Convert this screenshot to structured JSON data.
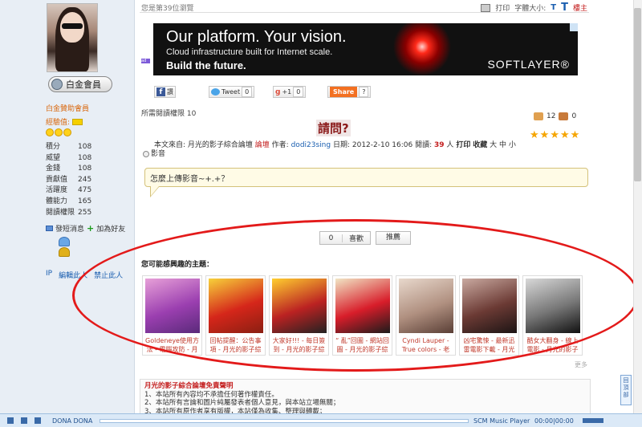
{
  "left": {
    "member_badge": "白金會員",
    "role": "白金贊助會員",
    "exp_label": "經驗值:",
    "stats": [
      {
        "k": "積分",
        "v": "108"
      },
      {
        "k": "威望",
        "v": "108"
      },
      {
        "k": "金錢",
        "v": "108"
      },
      {
        "k": "貢獻值",
        "v": "245"
      },
      {
        "k": "活躍度",
        "v": "475"
      },
      {
        "k": "體能力",
        "v": "165"
      },
      {
        "k": "閱讀權限",
        "v": "255"
      }
    ],
    "send_message": "發短消息",
    "add_friend": "加為好友",
    "ip": "IP",
    "edit_user": "編輯此人",
    "ban_user": "禁止此人"
  },
  "top": {
    "rank": "您是第39位瀏覽",
    "print": "打印",
    "font_size_label": "字體大小:",
    "font_small": "T",
    "font_large": "T",
    "floor": "樓主"
  },
  "ad": {
    "headline": "Our platform. Your vision.",
    "subline": "Cloud infrastructure built for Internet scale.",
    "cta": "Build the future.",
    "brand": "SOFTLAYER®",
    "tag": "ad"
  },
  "share": {
    "fb": "讚",
    "tweet": "Tweet",
    "tweet_count": "0",
    "gplus": "+1",
    "gplus_count": "0",
    "share_label": "Share",
    "share_count": "?"
  },
  "post": {
    "read_perm": "所需閱讀權限 10",
    "title": "請問?",
    "meta_from": "本文來自: 月光的影子綜合論壇",
    "meta_board": "論壇",
    "meta_author_label": "作者:",
    "meta_author": "dodi23sing",
    "meta_date": "日期: 2012-2-10 16:06 閱讀:",
    "meta_reads": "39",
    "meta_reads_unit": "人",
    "meta_print": "打印",
    "meta_collect": "收藏",
    "meta_sizes": "大 中 小",
    "meta_category": "影音",
    "thumbs_up": "12",
    "thumbs_down": "0",
    "content": "怎麼上傳影音~+.+？"
  },
  "actions": {
    "like_count": "0",
    "like_label": "喜歡",
    "recommend_label": "推薦"
  },
  "related": {
    "title": "您可能感興趣的主題：",
    "more": "更多",
    "items": [
      {
        "caption": "Goldeneye使用方法 - 電腦攻防 - 月",
        "colors": [
          "#e7a0d8",
          "#9b3fb0",
          "#5a2a7a"
        ]
      },
      {
        "caption": "回帖提醒：公告事項 - 月光的影子綜",
        "colors": [
          "#f7d23a",
          "#d5261a",
          "#8a1f12"
        ]
      },
      {
        "caption": "大家好!!! - 每日簽到 - 月光的影子綜",
        "colors": [
          "#ffcf2f",
          "#b22",
          "#222"
        ]
      },
      {
        "caption": "“ 亂”回圖 - 網站回圖 - 月光的影子綜",
        "colors": [
          "#f1e6c5",
          "#d81d2a",
          "#1b1b1b"
        ]
      },
      {
        "caption": "Cyndi Lauper - True colors - 老式",
        "colors": [
          "#e8d8cc",
          "#b09080",
          "#5a3f36"
        ]
      },
      {
        "caption": "凶宅驚悚 - 最新迅雷電影下載 - 月光",
        "colors": [
          "#c9a9a0",
          "#6b3a34",
          "#1c1414"
        ]
      },
      {
        "caption": "酷女大翻身 - 線上電影 - 月光的影子",
        "colors": [
          "#d8d8d8",
          "#777",
          "#111"
        ]
      }
    ]
  },
  "disclaimer": {
    "title": "月光的影子綜合論壇免責聲明",
    "line1": "1、本站所有內容均不承擔任何著作權責任。",
    "line2": "2、本站所有言論和圖片純屬發表者個人意見，與本站立場無關；",
    "line3": "3、本站所有原作者享有版權，本站僅為收集、整理與轉載；"
  },
  "side": {
    "back_to_top": "回頂部"
  },
  "player": {
    "track": "DONA DONA",
    "app": "SCM Music Player",
    "time": "00:00|00:00"
  }
}
